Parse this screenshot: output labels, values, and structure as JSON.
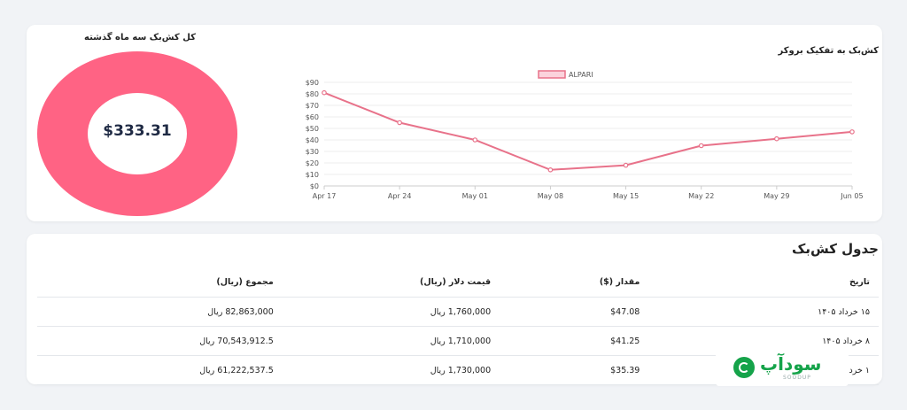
{
  "donut": {
    "title": "کل کش‌بک سه ماه گذشته",
    "value": "$333.31",
    "color": "#ff6384"
  },
  "broker_chart": {
    "title": "کش‌بک به تفکیک بروکر"
  },
  "chart_data": {
    "type": "line",
    "x": [
      "Apr 17",
      "Apr 24",
      "May 01",
      "May 08",
      "May 15",
      "May 22",
      "May 29",
      "Jun 05"
    ],
    "series": [
      {
        "name": "ALPARI",
        "values": [
          81,
          55,
          40,
          14,
          18,
          35,
          41,
          47
        ],
        "color": "#e8728a"
      }
    ],
    "yticks": [
      "$0",
      "$10",
      "$20",
      "$30",
      "$40",
      "$50",
      "$60",
      "$70",
      "$80",
      "$90"
    ],
    "ylim": [
      0,
      90
    ],
    "grid": true,
    "legend": "top"
  },
  "table": {
    "title": "جدول کش‌بک",
    "headers": {
      "date": "تاریخ",
      "amount": "مقدار ($)",
      "price": "قیمت دلار (ریال)",
      "total": "مجموع (ریال)"
    },
    "rows": [
      {
        "date": "۱۵ خرداد ۱۴۰۵",
        "amount": "$47.08",
        "price": "1,760,000 ریال",
        "total": "82,863,000 ریال"
      },
      {
        "date": "۸ خرداد ۱۴۰۵",
        "amount": "$41.25",
        "price": "1,710,000 ریال",
        "total": "70,543,912.5 ریال"
      },
      {
        "date": "۱ خرد",
        "amount": "$35.39",
        "price": "1,730,000 ریال",
        "total": "61,222,537.5 ریال"
      }
    ]
  },
  "watermark": {
    "text": "سودآپ",
    "sub": "SOODUP"
  }
}
